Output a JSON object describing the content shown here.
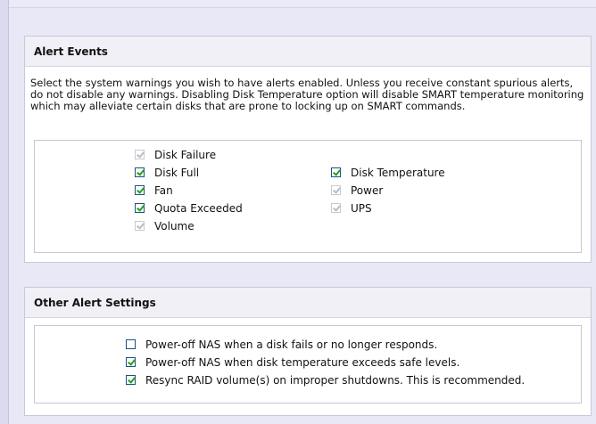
{
  "alert_events": {
    "title": "Alert Events",
    "description": "Select the system warnings you wish to have alerts enabled. Unless you receive constant spurious alerts, do not disable any warnings. Disabling Disk Temperature option will disable SMART temperature monitoring which may alleviate certain disks that are prone to locking up on SMART commands.",
    "options": [
      {
        "label": "Disk Failure",
        "checked": true,
        "disabled": true
      },
      {
        "label": "Disk Full",
        "checked": true,
        "disabled": false
      },
      {
        "label": "Disk Temperature",
        "checked": true,
        "disabled": false
      },
      {
        "label": "Fan",
        "checked": true,
        "disabled": false
      },
      {
        "label": "Power",
        "checked": true,
        "disabled": true
      },
      {
        "label": "Quota Exceeded",
        "checked": true,
        "disabled": false
      },
      {
        "label": "UPS",
        "checked": true,
        "disabled": true
      },
      {
        "label": "Volume",
        "checked": true,
        "disabled": true
      }
    ]
  },
  "other_alert_settings": {
    "title": "Other Alert Settings",
    "options": [
      {
        "label": "Power-off NAS when a disk fails or no longer responds.",
        "checked": false,
        "disabled": false
      },
      {
        "label": "Power-off NAS when disk temperature exceeds safe levels.",
        "checked": true,
        "disabled": false
      },
      {
        "label": "Resync RAID volume(s) on improper shutdowns. This is recommended.",
        "checked": true,
        "disabled": false
      }
    ]
  }
}
